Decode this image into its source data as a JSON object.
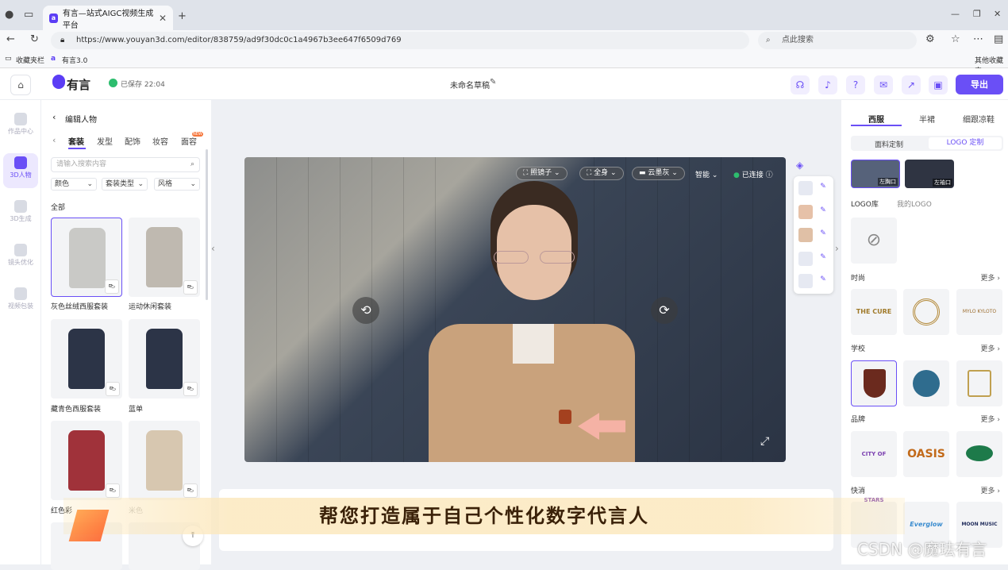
{
  "browser": {
    "tab_title": "有言—站式AIGC视频生成平台",
    "url": "https://www.youyan3d.com/editor/838759/ad9f30dc0c1a4967b3ee647f6509d769",
    "search_placeholder": "点此搜索",
    "bookmarks": [
      "收藏夹栏",
      "有言3.0"
    ],
    "other_bookmarks": "其他收藏夹"
  },
  "header": {
    "logo_text": "有言",
    "save_status": "已保存 22:04",
    "draft_name": "未命名草稿",
    "export_label": "导出"
  },
  "rail": {
    "items": [
      "作品中心",
      "3D人物",
      "3D生成",
      "镜头优化",
      "视频包装"
    ]
  },
  "left_panel": {
    "back_label": "编辑人物",
    "tabs": [
      "套装",
      "发型",
      "配饰",
      "妆容",
      "面容"
    ],
    "new_badge": "NEW",
    "search_placeholder": "请输入搜索内容",
    "filters": [
      "颜色",
      "套装类型",
      "风格"
    ],
    "section": "全部",
    "items": [
      {
        "label": "灰色丝绒西服套装",
        "color": "#c9c9c6"
      },
      {
        "label": "运动休闲套装",
        "color": "#bfb9b0"
      },
      {
        "label": "藏青色西服套装",
        "color": "#2c3447"
      },
      {
        "label": "蓝单",
        "color": "#2c3447"
      },
      {
        "label": "红色彩",
        "color": "#a0323a"
      },
      {
        "label": "米色",
        "color": "#d7c7b0"
      }
    ]
  },
  "viewport": {
    "pills": [
      "照镜子",
      "全身",
      "云墨灰",
      "智能"
    ],
    "connected": "已连接"
  },
  "right_panel": {
    "tabs": [
      "西服",
      "半裙",
      "细跟凉鞋"
    ],
    "subtabs": [
      "面料定制",
      "LOGO 定制"
    ],
    "positions": [
      "左胸口",
      "左袖口"
    ],
    "lib_tabs": [
      "LOGO库",
      "我的LOGO"
    ],
    "sections": [
      {
        "title": "时尚",
        "more": "更多",
        "tiles": [
          "THE CURE",
          "",
          "MYLO KYLOTO"
        ]
      },
      {
        "title": "学校",
        "more": "更多",
        "tiles": [
          "",
          "",
          ""
        ]
      },
      {
        "title": "品牌",
        "more": "更多",
        "tiles": [
          "CITY OF STARS",
          "OASIS",
          ""
        ]
      },
      {
        "title": "快消",
        "more": "更多",
        "tiles": [
          "",
          "Everglow",
          "MOON MUSIC"
        ]
      }
    ]
  },
  "subtitle": "帮您打造属于自己个性化数字代言人",
  "watermark": "CSDN @魔珐有言",
  "colors": {
    "accent": "#6a4ff6"
  }
}
